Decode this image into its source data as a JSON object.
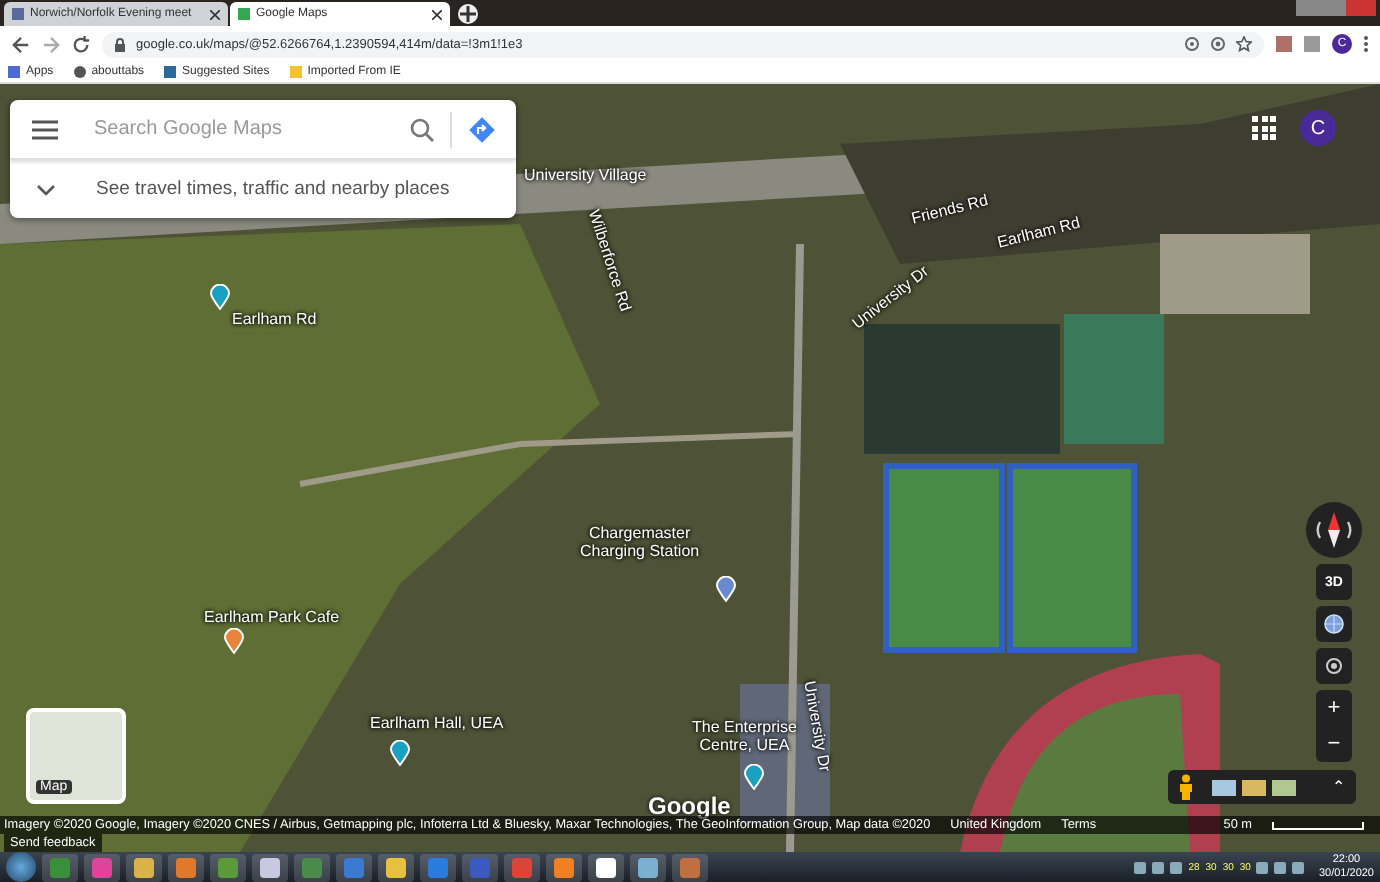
{
  "browser": {
    "tabs": [
      {
        "title": "Norwich/Norfolk Evening meet",
        "selected": false
      },
      {
        "title": "Google Maps",
        "selected": true
      }
    ],
    "url": "google.co.uk/maps/@52.6266764,1.2390594,414m/data=!3m1!1e3",
    "profile_initial": "C",
    "bookmarks": [
      "Apps",
      "abouttabs",
      "Suggested Sites",
      "Imported From IE"
    ]
  },
  "search_panel": {
    "placeholder": "Search Google Maps",
    "hint": "See travel times, traffic and nearby places"
  },
  "map": {
    "account_initial": "C",
    "labels": [
      "University Village",
      "Wilberforce Rd",
      "Friends Rd",
      "Earlham Rd",
      "Earlham Rd",
      "University Dr",
      "Earlham Park Cafe",
      "Chargemaster\nCharging Station",
      "Earlham Hall, UEA",
      "The Enterprise\nCentre, UEA",
      "University Dr"
    ],
    "logo": "Google",
    "minimap_label": "Map",
    "controls": {
      "three_d": "3D",
      "zoom_in": "+",
      "zoom_out": "−",
      "expand": "⌃"
    },
    "attribution": "Imagery ©2020 Google, Imagery ©2020 CNES / Airbus, Getmapping plc, Infoterra Ltd & Bluesky, Maxar Technologies, The GeoInformation Group, Map data ©2020",
    "region": "United Kingdom",
    "terms": "Terms",
    "scale": "50 m",
    "feedback": "Send feedback"
  },
  "taskbar": {
    "tray_numbers": [
      "28",
      "30",
      "30",
      "30"
    ],
    "time": "22:00",
    "date": "30/01/2020"
  }
}
